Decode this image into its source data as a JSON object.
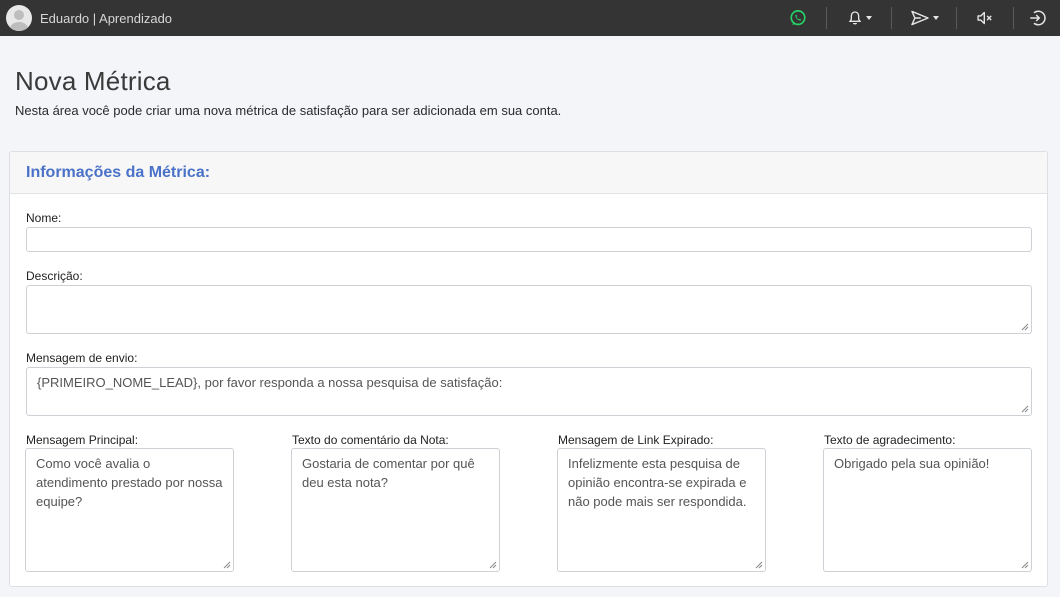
{
  "topbar": {
    "user_label": "Eduardo | Aprendizado",
    "icons": [
      "avatar",
      "whatsapp-icon",
      "bell-icon",
      "send-icon",
      "mute-icon",
      "logout-icon"
    ],
    "whatsapp_color": "#25d366",
    "background": "#343434"
  },
  "page": {
    "title": "Nova Métrica",
    "description": "Nesta área você pode criar uma nova métrica de satisfação para ser adicionada em sua conta."
  },
  "card": {
    "title": "Informações da Métrica:",
    "title_color": "#4b72c9"
  },
  "form": {
    "nome": {
      "label": "Nome:",
      "value": ""
    },
    "descricao": {
      "label": "Descrição:",
      "value": ""
    },
    "mensagem_envio": {
      "label": "Mensagem de envio:",
      "value": "{PRIMEIRO_NOME_LEAD}, por favor responda a nossa pesquisa de satisfação:"
    },
    "mensagem_principal": {
      "label": "Mensagem Principal:",
      "value": "Como você avalia o atendimento prestado por nossa equipe?"
    },
    "texto_comentario": {
      "label": "Texto do comentário da Nota:",
      "value": "Gostaria de comentar por quê deu esta nota?"
    },
    "mensagem_link_expirado": {
      "label": "Mensagem de Link Expirado:",
      "value": "Infelizmente esta pesquisa de opinião encontra-se expirada e não pode mais ser respondida."
    },
    "texto_agradecimento": {
      "label": "Texto de agradecimento:",
      "value": "Obrigado pela sua opinião!"
    }
  }
}
